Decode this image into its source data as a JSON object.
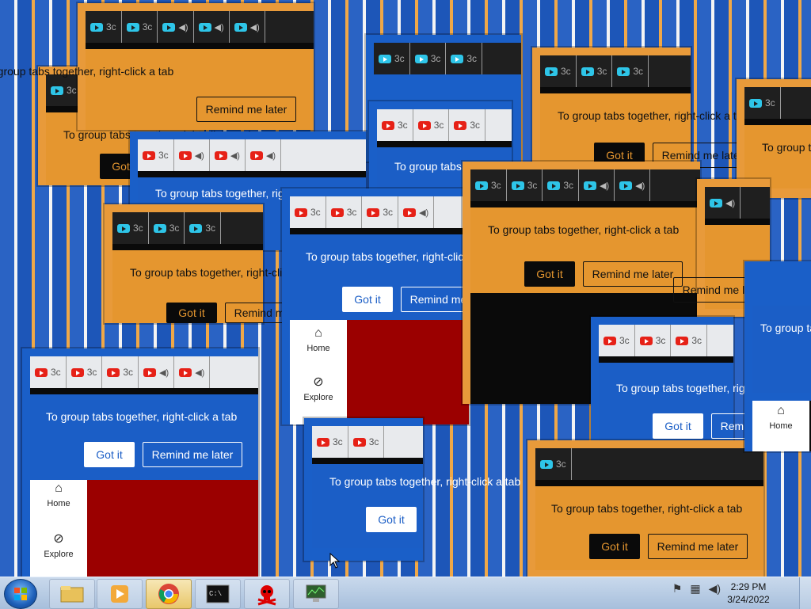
{
  "popup": {
    "message": "To group tabs together, right-click a tab",
    "got_it": "Got it",
    "remind_later": "Remind me later"
  },
  "tab": {
    "text": "3c"
  },
  "nav": {
    "home": "Home",
    "explore": "Explore"
  },
  "taskbar": {
    "apps": [
      {
        "name": "file-explorer-icon"
      },
      {
        "name": "media-player-icon"
      },
      {
        "name": "chrome-icon",
        "active": true
      },
      {
        "name": "command-prompt-icon"
      },
      {
        "name": "skull-icon"
      },
      {
        "name": "task-manager-icon"
      }
    ],
    "time": "2:29 PM",
    "date": "3/24/2022"
  },
  "colors": {
    "blue_popup": "#1b5ec6",
    "orange_popup": "#e5962f",
    "youtube_red": "#e62117",
    "youtube_cyan": "#2ec5e8"
  }
}
